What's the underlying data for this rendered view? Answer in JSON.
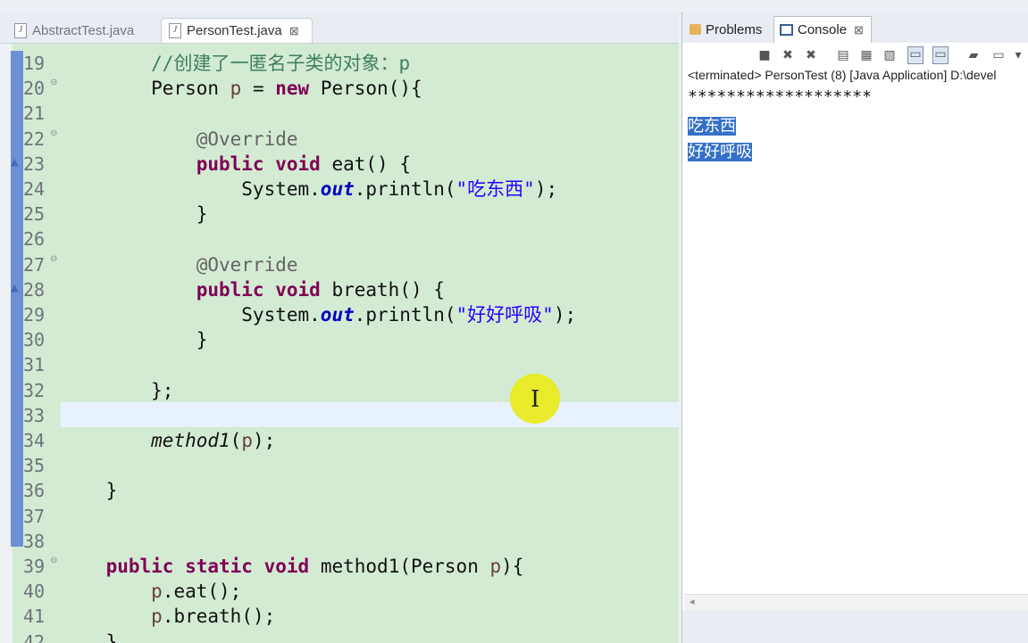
{
  "editor_tabs": [
    {
      "label": "AbstractTest.java",
      "active": false
    },
    {
      "label": "PersonTest.java",
      "active": true,
      "close": "⊠"
    }
  ],
  "code_lines": [
    {
      "num": "19",
      "tokens": [
        {
          "t": "        "
        },
        {
          "t": "//创建了一匿名子类的对象：p",
          "c": "cmt"
        }
      ]
    },
    {
      "num": "20",
      "fold": true,
      "tokens": [
        {
          "t": "        Person "
        },
        {
          "t": "p",
          "c": "param"
        },
        {
          "t": " = "
        },
        {
          "t": "new",
          "c": "kw"
        },
        {
          "t": " Person(){"
        }
      ]
    },
    {
      "num": "21",
      "tokens": []
    },
    {
      "num": "22",
      "fold": true,
      "tokens": [
        {
          "t": "            "
        },
        {
          "t": "@Override",
          "c": "ann"
        }
      ]
    },
    {
      "num": "23",
      "override": true,
      "tokens": [
        {
          "t": "            "
        },
        {
          "t": "public",
          "c": "kw"
        },
        {
          "t": " "
        },
        {
          "t": "void",
          "c": "kw"
        },
        {
          "t": " eat() {"
        }
      ]
    },
    {
      "num": "24",
      "tokens": [
        {
          "t": "                System."
        },
        {
          "t": "out",
          "c": "fld"
        },
        {
          "t": ".println("
        },
        {
          "t": "\"吃东西\"",
          "c": "str"
        },
        {
          "t": ");"
        }
      ]
    },
    {
      "num": "25",
      "tokens": [
        {
          "t": "            }"
        }
      ]
    },
    {
      "num": "26",
      "tokens": []
    },
    {
      "num": "27",
      "fold": true,
      "tokens": [
        {
          "t": "            "
        },
        {
          "t": "@Override",
          "c": "ann"
        }
      ]
    },
    {
      "num": "28",
      "override": true,
      "tokens": [
        {
          "t": "            "
        },
        {
          "t": "public",
          "c": "kw"
        },
        {
          "t": " "
        },
        {
          "t": "void",
          "c": "kw"
        },
        {
          "t": " breath() {"
        }
      ]
    },
    {
      "num": "29",
      "tokens": [
        {
          "t": "                System."
        },
        {
          "t": "out",
          "c": "fld"
        },
        {
          "t": ".println("
        },
        {
          "t": "\"好好呼吸\"",
          "c": "str"
        },
        {
          "t": ");"
        }
      ]
    },
    {
      "num": "30",
      "tokens": [
        {
          "t": "            }"
        }
      ]
    },
    {
      "num": "31",
      "tokens": []
    },
    {
      "num": "32",
      "tokens": [
        {
          "t": "        };"
        }
      ]
    },
    {
      "num": "33",
      "tokens": []
    },
    {
      "num": "34",
      "tokens": [
        {
          "t": "        "
        },
        {
          "t": "method1",
          "c": "ital"
        },
        {
          "t": "("
        },
        {
          "t": "p",
          "c": "param"
        },
        {
          "t": ");"
        }
      ]
    },
    {
      "num": "35",
      "tokens": []
    },
    {
      "num": "36",
      "tokens": [
        {
          "t": "    }"
        }
      ]
    },
    {
      "num": "37",
      "tokens": []
    },
    {
      "num": "38",
      "tokens": []
    },
    {
      "num": "39",
      "fold": true,
      "tokens": [
        {
          "t": "    "
        },
        {
          "t": "public",
          "c": "kw"
        },
        {
          "t": " "
        },
        {
          "t": "static",
          "c": "kw"
        },
        {
          "t": " "
        },
        {
          "t": "void",
          "c": "kw"
        },
        {
          "t": " method1(Person "
        },
        {
          "t": "p",
          "c": "param"
        },
        {
          "t": "){"
        }
      ]
    },
    {
      "num": "40",
      "tokens": [
        {
          "t": "        "
        },
        {
          "t": "p",
          "c": "param"
        },
        {
          "t": ".eat();"
        }
      ]
    },
    {
      "num": "41",
      "tokens": [
        {
          "t": "        "
        },
        {
          "t": "p",
          "c": "param"
        },
        {
          "t": ".breath();"
        }
      ]
    },
    {
      "num": "42",
      "tokens": [
        {
          "t": "    }"
        }
      ]
    }
  ],
  "right_panel": {
    "tab_problems": "Problems",
    "tab_console": "Console",
    "tab_close": "⊠",
    "terminated_line": "<terminated> PersonTest (8) [Java Application] D:\\devel",
    "console_lines": [
      "*******************",
      "吃东西",
      "好好呼吸"
    ]
  }
}
